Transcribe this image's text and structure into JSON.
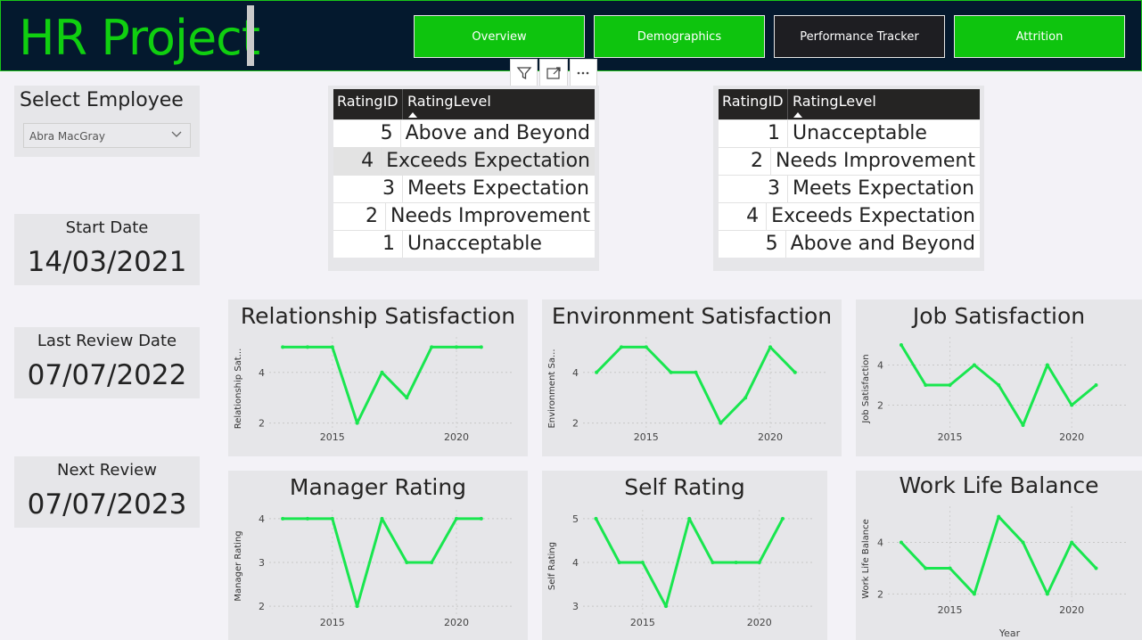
{
  "app": {
    "title": "HR Project"
  },
  "nav": [
    {
      "label": "Overview",
      "color": "#0ec40e"
    },
    {
      "label": "Demographics",
      "color": "#0ec40e"
    },
    {
      "label": "Performance Tracker",
      "color": "#1e1e22"
    },
    {
      "label": "Attrition",
      "color": "#0ec40e"
    }
  ],
  "toolbar": {
    "icons": [
      "filter-icon",
      "focus-mode-icon",
      "more-options-icon"
    ]
  },
  "slicer": {
    "title": "Select Employee",
    "selected": "Abra MacGray"
  },
  "dates": {
    "start": {
      "label": "Start Date",
      "value": "14/03/2021"
    },
    "last_review": {
      "label": "Last Review Date",
      "value": "07/07/2022"
    },
    "next_review": {
      "label": "Next Review",
      "value": "07/07/2023"
    }
  },
  "tables": [
    {
      "headers": [
        "RatingID",
        "RatingLevel"
      ],
      "rows": [
        [
          "5",
          "Above and Beyond"
        ],
        [
          "4",
          "Exceeds Expectation"
        ],
        [
          "3",
          "Meets Expectation"
        ],
        [
          "2",
          "Needs Improvement"
        ],
        [
          "1",
          "Unacceptable"
        ]
      ]
    },
    {
      "headers": [
        "RatingID",
        "RatingLevel"
      ],
      "rows": [
        [
          "1",
          "Unacceptable"
        ],
        [
          "2",
          "Needs Improvement"
        ],
        [
          "3",
          "Meets Expectation"
        ],
        [
          "4",
          "Exceeds Expectation"
        ],
        [
          "5",
          "Above and Beyond"
        ]
      ]
    }
  ],
  "colors": {
    "line": "#19e64f",
    "accent": "#10cf10",
    "header_bg": "#04192e"
  },
  "chart_data": [
    {
      "type": "line",
      "title": "Relationship Satisfaction",
      "ylabel": "Relationship Sat...",
      "xlabel": "",
      "x": [
        2013,
        2014,
        2015,
        2016,
        2017,
        2018,
        2019,
        2020,
        2021,
        2022
      ],
      "values": [
        5,
        5,
        5,
        2,
        4,
        3,
        5,
        5,
        5
      ],
      "xticks": [
        2015,
        2020
      ],
      "yticks": [
        2,
        4
      ],
      "ylim": [
        1.6,
        5.4
      ],
      "xlim": [
        2012.6,
        2022.3
      ]
    },
    {
      "type": "line",
      "title": "Environment Satisfaction",
      "ylabel": "Environment Sa...",
      "xlabel": "",
      "x": [
        2013,
        2014,
        2015,
        2016,
        2017,
        2018,
        2019,
        2020,
        2021,
        2022
      ],
      "values": [
        4,
        5,
        5,
        4,
        4,
        2,
        3,
        5,
        4
      ],
      "xticks": [
        2015,
        2020
      ],
      "yticks": [
        2,
        4
      ],
      "ylim": [
        1.6,
        5.4
      ],
      "xlim": [
        2012.6,
        2022.3
      ]
    },
    {
      "type": "line",
      "title": "Job Satisfaction",
      "ylabel": "Job Satisfaction",
      "xlabel": "",
      "x": [
        2013,
        2014,
        2015,
        2016,
        2017,
        2018,
        2019,
        2020,
        2021,
        2022
      ],
      "values": [
        5,
        3,
        3,
        4,
        3,
        1,
        4,
        2,
        3
      ],
      "xticks": [
        2015,
        2020
      ],
      "yticks": [
        2,
        4
      ],
      "ylim": [
        0.6,
        5.4
      ],
      "xlim": [
        2012.6,
        2022.3
      ]
    },
    {
      "type": "line",
      "title": "Manager Rating",
      "ylabel": "Manager Rating",
      "xlabel": "",
      "x": [
        2013,
        2014,
        2015,
        2016,
        2017,
        2018,
        2019,
        2020,
        2021,
        2022
      ],
      "values": [
        4,
        4,
        4,
        2,
        4,
        3,
        3,
        4,
        4
      ],
      "xticks": [
        2015,
        2020
      ],
      "yticks": [
        2,
        3,
        4
      ],
      "ylim": [
        1.8,
        4.2
      ],
      "xlim": [
        2012.6,
        2022.3
      ]
    },
    {
      "type": "line",
      "title": "Self Rating",
      "ylabel": "Self Rating",
      "xlabel": "",
      "x": [
        2013,
        2014,
        2015,
        2016,
        2017,
        2018,
        2019,
        2020,
        2021,
        2022
      ],
      "values": [
        5,
        4,
        4,
        3,
        5,
        4,
        4,
        4,
        5
      ],
      "xticks": [
        2015,
        2020
      ],
      "yticks": [
        3,
        4,
        5
      ],
      "ylim": [
        2.8,
        5.2
      ],
      "xlim": [
        2012.6,
        2022.3
      ]
    },
    {
      "type": "line",
      "title": "Work Life Balance",
      "ylabel": "Work Life Balance",
      "xlabel": "Year",
      "x": [
        2013,
        2014,
        2015,
        2016,
        2017,
        2018,
        2019,
        2020,
        2021,
        2022
      ],
      "values": [
        4,
        3,
        3,
        2,
        5,
        4,
        2,
        4,
        3
      ],
      "xticks": [
        2015,
        2020
      ],
      "yticks": [
        2,
        4
      ],
      "ylim": [
        1.6,
        5.4
      ],
      "xlim": [
        2012.6,
        2022.3
      ]
    }
  ]
}
